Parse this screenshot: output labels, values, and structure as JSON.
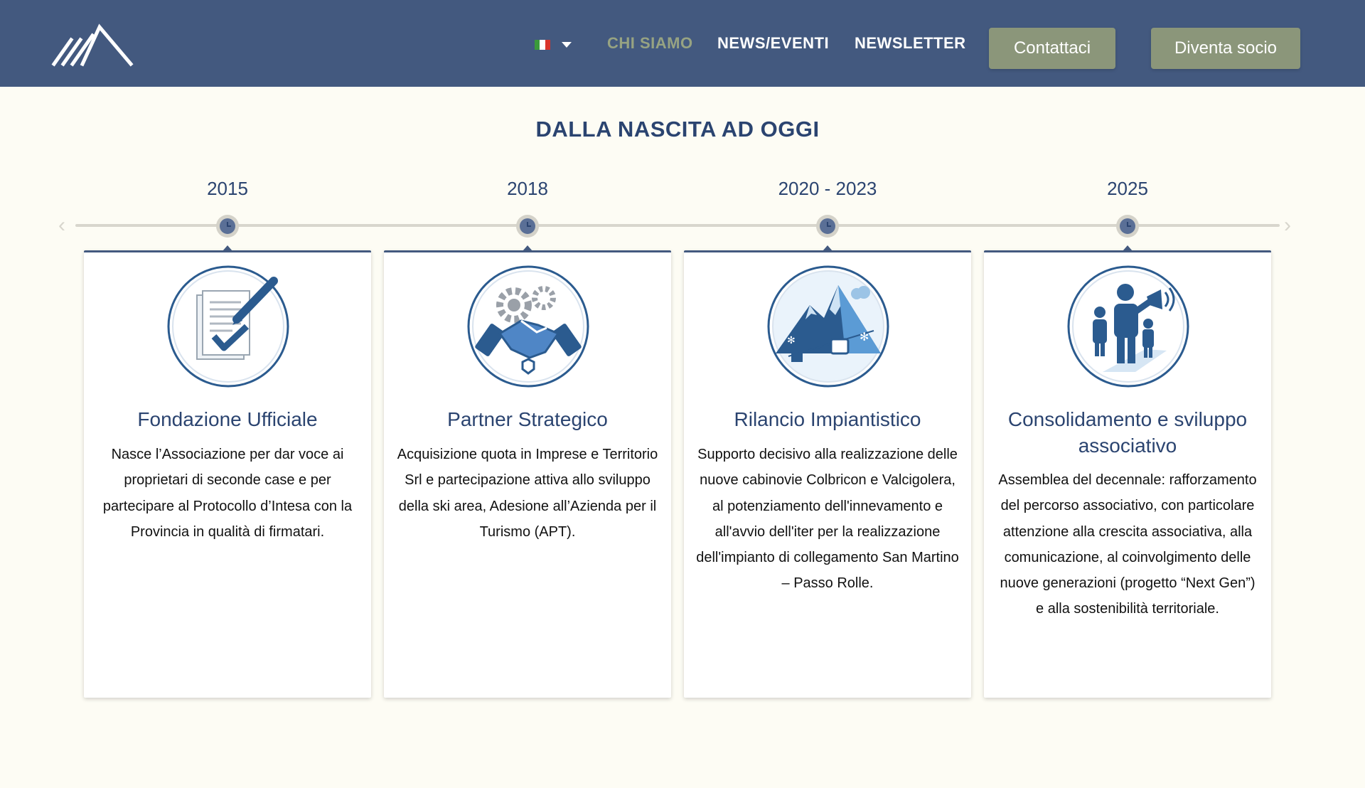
{
  "header": {
    "language": "it",
    "nav": {
      "chi_siamo": "CHI SIAMO",
      "news_eventi": "NEWS/EVENTI",
      "newsletter": "NEWSLETTER"
    },
    "buttons": {
      "contattaci": "Contattaci",
      "diventa_socio": "Diventa socio"
    },
    "colors": {
      "background": "#43597f",
      "active_link": "#97a382",
      "button": "#8b967a"
    }
  },
  "section": {
    "title": "DALLA NASCITA AD OGGI"
  },
  "timeline": [
    {
      "year": "2015",
      "icon": "document-signature-icon",
      "title": "Fondazione Ufficiale",
      "text": "Nasce l’Associazione per dar voce ai proprietari di seconde case e per partecipare al Protocollo d’Intesa con la Provincia in qualità di firmatari."
    },
    {
      "year": "2018",
      "icon": "handshake-gears-icon",
      "title": "Partner Strategico",
      "text": "Acquisizione quota in Imprese e Territorio Srl e partecipazione attiva allo sviluppo della ski area, Adesione all’Azienda per il Turismo (APT)."
    },
    {
      "year": "2020 - 2023",
      "icon": "mountain-cablecar-icon",
      "title": "Rilancio Impiantistico",
      "text": "Supporto decisivo alla realizzazione delle nuove cabinovie Colbricon e Valcigolera, al potenziamento dell'innevamento e all'avvio dell'iter per la realizzazione dell'impianto di collegamento San Martino – Passo Rolle."
    },
    {
      "year": "2025",
      "icon": "people-megaphone-icon",
      "title": "Consolidamento e sviluppo associativo",
      "text": "Assemblea del decennale: rafforzamento del percorso associativo, con particolare attenzione alla crescita associativa, alla comunicazione, al coinvolgimento delle nuove generazioni (progetto “Next Gen”) e alla sostenibilità territoriale."
    }
  ]
}
